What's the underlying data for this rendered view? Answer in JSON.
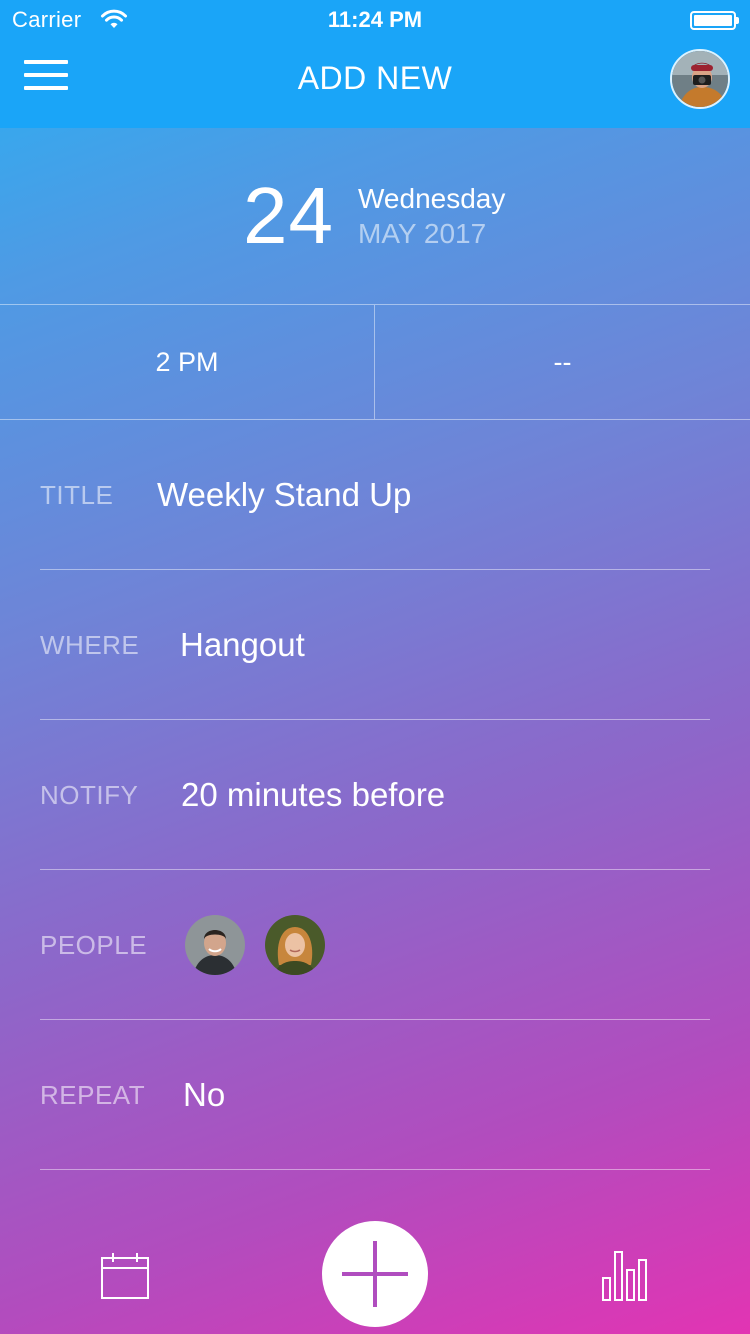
{
  "status_bar": {
    "carrier": "Carrier",
    "time": "11:24 PM"
  },
  "header": {
    "title": "ADD NEW",
    "menu_icon": "hamburger-menu-icon",
    "avatar": "user-avatar-photographer"
  },
  "date": {
    "day": "24",
    "weekday": "Wednesday",
    "month_year": "MAY 2017"
  },
  "time": {
    "start": "2 PM",
    "end": "--"
  },
  "form": {
    "title": {
      "label": "TITLE",
      "value": "Weekly Stand Up"
    },
    "where": {
      "label": "WHERE",
      "value": "Hangout"
    },
    "notify": {
      "label": "NOTIFY",
      "value": "20 minutes before"
    },
    "people": {
      "label": "PEOPLE",
      "avatars": [
        "person-avatar-man",
        "person-avatar-woman"
      ]
    },
    "repeat": {
      "label": "REPEAT",
      "value": "No"
    }
  },
  "bottom_nav": {
    "left_icon": "calendar-icon",
    "center_icon": "plus-icon",
    "right_icon": "bar-chart-icon"
  },
  "colors": {
    "topbar": "#1aa5f8",
    "gradient_start": "#27b1f4",
    "gradient_end": "#e234b3",
    "accent_plus": "#b04dbf"
  }
}
